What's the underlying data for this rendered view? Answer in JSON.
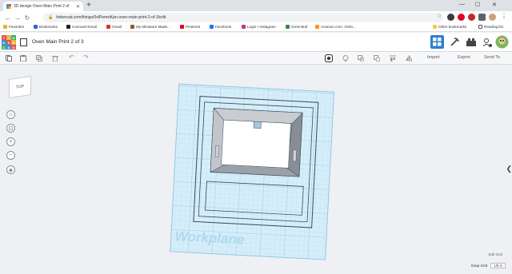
{
  "browser": {
    "tab_title": "3D design Oven Main Print 2 of",
    "url": "tinkercad.com/things/0xlPemxiKpn-oven-main-print-2-of-3/edit",
    "bookmarks": [
      {
        "label": "Favorites",
        "color": "#e6b32e"
      },
      {
        "label": "Bookmarks",
        "color": "#3367d6"
      },
      {
        "label": "Comcast Email",
        "color": "#222222"
      },
      {
        "label": "Gmail",
        "color": "#d93025"
      },
      {
        "label": "My Miniature Made...",
        "color": "#8b5a2b"
      },
      {
        "label": "Pinterest",
        "color": "#e60023"
      },
      {
        "label": "Facebook",
        "color": "#1877f2"
      },
      {
        "label": "Login • Instagram",
        "color": "#c13584"
      },
      {
        "label": "Greenleaf",
        "color": "#3a8a3a"
      },
      {
        "label": "Amazon.com: Onlin...",
        "color": "#ff9900"
      }
    ],
    "other_bookmarks": "Other bookmarks",
    "reading_list": "Reading list"
  },
  "app": {
    "logo_letters": [
      "T",
      "I",
      "N",
      "K",
      "E",
      "R",
      "C",
      "A",
      "D"
    ],
    "logo_colors": [
      "#e5534b",
      "#f2b233",
      "#38b267",
      "#3a8ee6",
      "#e5534b",
      "#f2b233",
      "#38b267",
      "#3a8ee6",
      "#e5534b"
    ],
    "project_title": "Oven Main Print 2 of 3"
  },
  "toolbar": {
    "import_label": "Import",
    "export_label": "Export",
    "send_label": "Send To"
  },
  "workspace": {
    "viewcube_label": "TOP",
    "workplane_label": "Workplane",
    "edit_grid_label": "Edit Grid",
    "snap_grid_label": "Snap Grid",
    "snap_grid_value": "1/8 in"
  },
  "colors": {
    "accent": "#2d7fd3",
    "grid_fill": "#cde9f6",
    "grid_line": "#9fd0ea",
    "object_stroke": "#3b4a5a"
  }
}
